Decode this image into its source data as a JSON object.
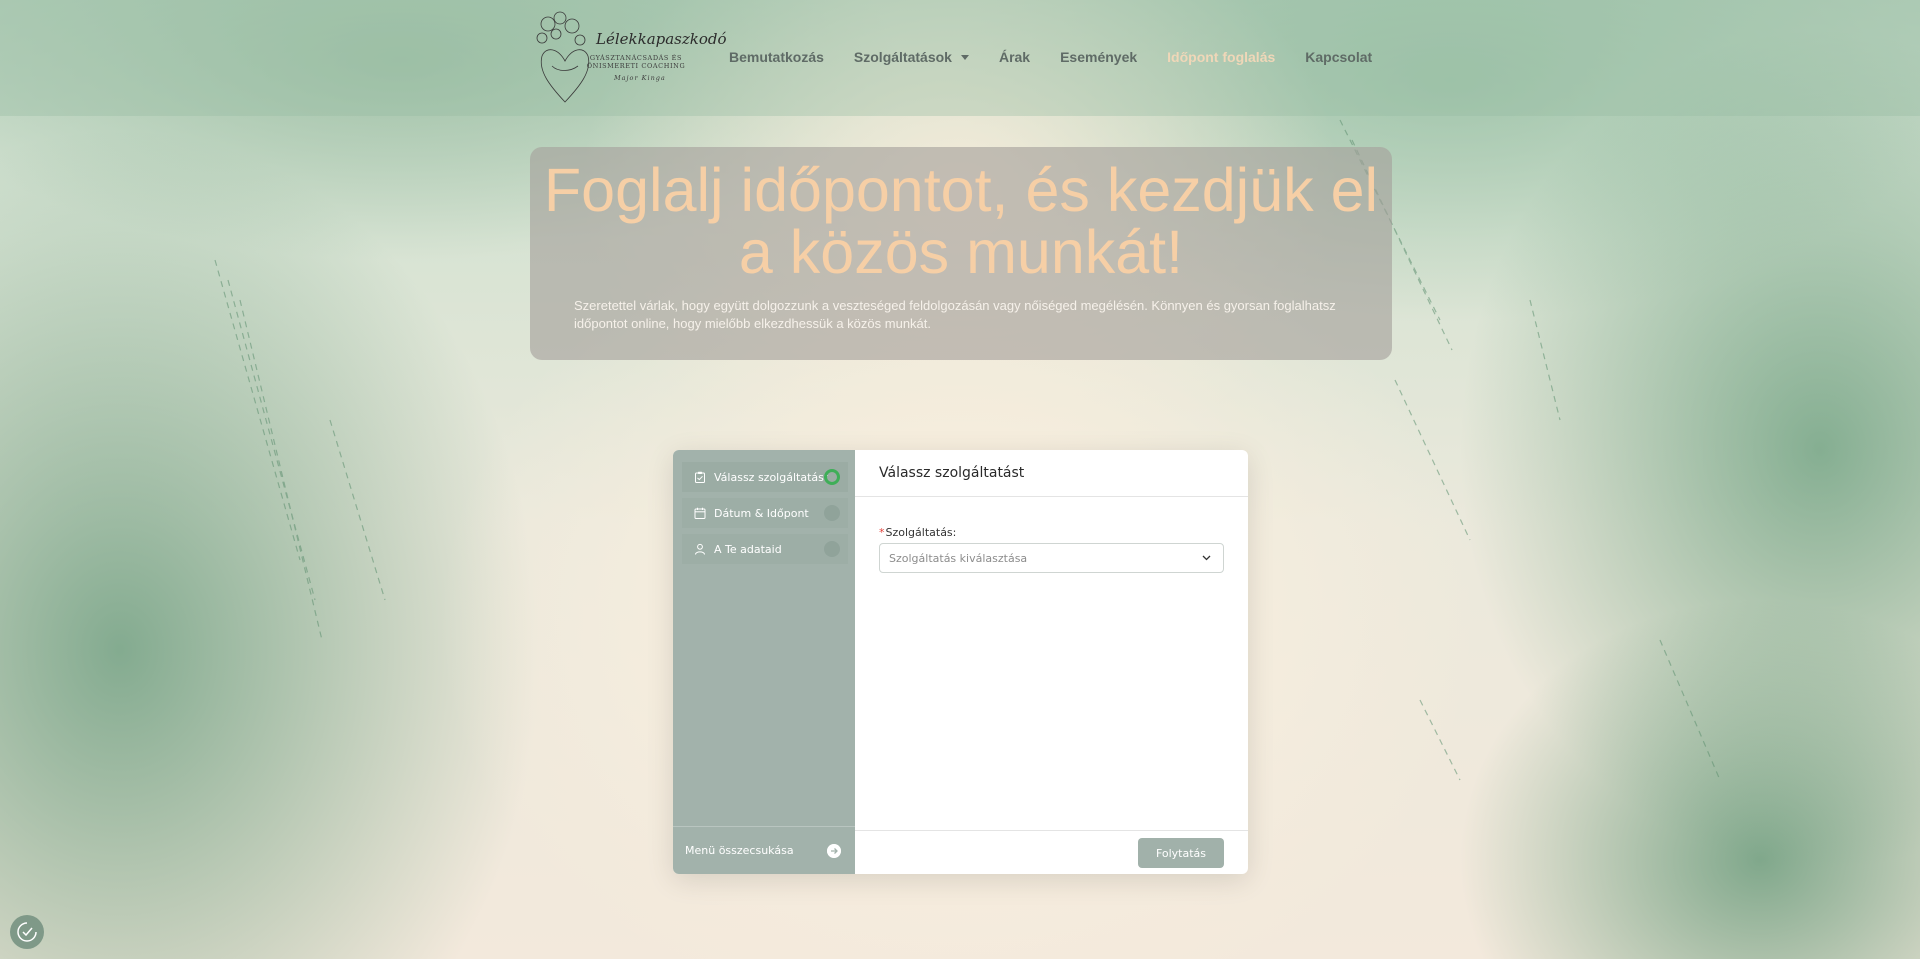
{
  "brand": {
    "title": "Lélekkapaszkodó",
    "subtitle_line1": "GYÁSZTANÁCSADÁS ÉS",
    "subtitle_line2": "ÖNISMERETI COACHING",
    "signature": "Major Kinga"
  },
  "nav": {
    "items": [
      {
        "label": "Bemutatkozás"
      },
      {
        "label": "Szolgáltatások",
        "has_dropdown": true
      },
      {
        "label": "Árak"
      },
      {
        "label": "Események"
      },
      {
        "label": "Időpont foglalás",
        "active": true
      },
      {
        "label": "Kapcsolat"
      }
    ]
  },
  "hero": {
    "title": "Foglalj időpontot, és kezdjük el a közös munkát!",
    "text": "Szeretettel várlak, hogy együtt dolgozzunk a veszteséged feldolgozásán vagy nőiséged megélésén. Könnyen és gyorsan foglalhatsz időpontot online, hogy mielőbb elkezdhessük a közös munkát."
  },
  "booking": {
    "steps": [
      {
        "label": "Válassz szolgáltatást",
        "icon": "clipboard-icon",
        "active": true
      },
      {
        "label": "Dátum & Időpont",
        "icon": "calendar-icon"
      },
      {
        "label": "A Te adataid",
        "icon": "user-icon"
      }
    ],
    "collapse_label": "Menü összecsukása",
    "panel_title": "Válassz szolgáltatást",
    "field_required_mark": "*",
    "field_label": "Szolgáltatás:",
    "select_placeholder": "Szolgáltatás kiválasztása",
    "continue_label": "Folytatás"
  },
  "colors": {
    "sidebar": "#a2b2ab",
    "active_indicator": "#3fae58",
    "hero_title": "#f6cfa6",
    "nav_active": "#f0d7b8"
  }
}
